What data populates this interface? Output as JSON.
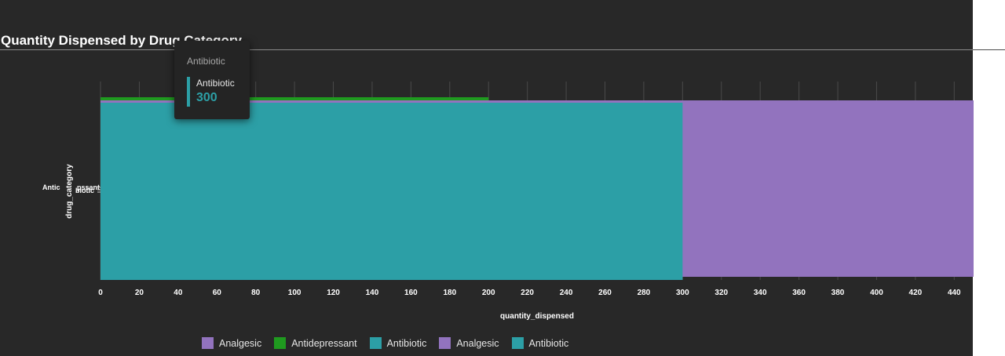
{
  "title": "Quantity Dispensed by Drug Category",
  "colors": {
    "Analgesic": "#9273be",
    "Antidepressant": "#1f9a1f",
    "Antibiotic": "#2c9fa6"
  },
  "tooltip": {
    "header": "Antibiotic",
    "series_name": "Antibiotic",
    "value": "300"
  },
  "legend": [
    {
      "label": "Analgesic",
      "color": "#9273be"
    },
    {
      "label": "Antidepressant",
      "color": "#1f9a1f"
    },
    {
      "label": "Antibiotic",
      "color": "#2c9fa6"
    },
    {
      "label": "Analgesic",
      "color": "#9273be"
    },
    {
      "label": "Antibiotic",
      "color": "#2c9fa6"
    }
  ],
  "chart_data": {
    "type": "bar",
    "orientation": "horizontal",
    "title": "Quantity Dispensed by Drug Category",
    "xlabel": "quantity_dispensed",
    "ylabel": "drug_category",
    "xlim": [
      0,
      450
    ],
    "xticks": [
      0,
      20,
      40,
      60,
      80,
      100,
      120,
      140,
      160,
      180,
      200,
      220,
      240,
      260,
      280,
      300,
      320,
      340,
      360,
      380,
      400,
      420,
      440
    ],
    "categories": [
      "Analgesic",
      "Antidepressant",
      "Antibiotic"
    ],
    "category_labels_visible": [
      "Antic",
      "pssant",
      "biotic"
    ],
    "series": [
      {
        "name": "Analgesic",
        "color": "#9273be",
        "values": [
          450
        ]
      },
      {
        "name": "Antidepressant",
        "color": "#1f9a1f",
        "values": [
          200
        ]
      },
      {
        "name": "Antibiotic",
        "color": "#2c9fa6",
        "values": [
          300
        ]
      }
    ],
    "grid": true,
    "legend_position": "bottom"
  }
}
